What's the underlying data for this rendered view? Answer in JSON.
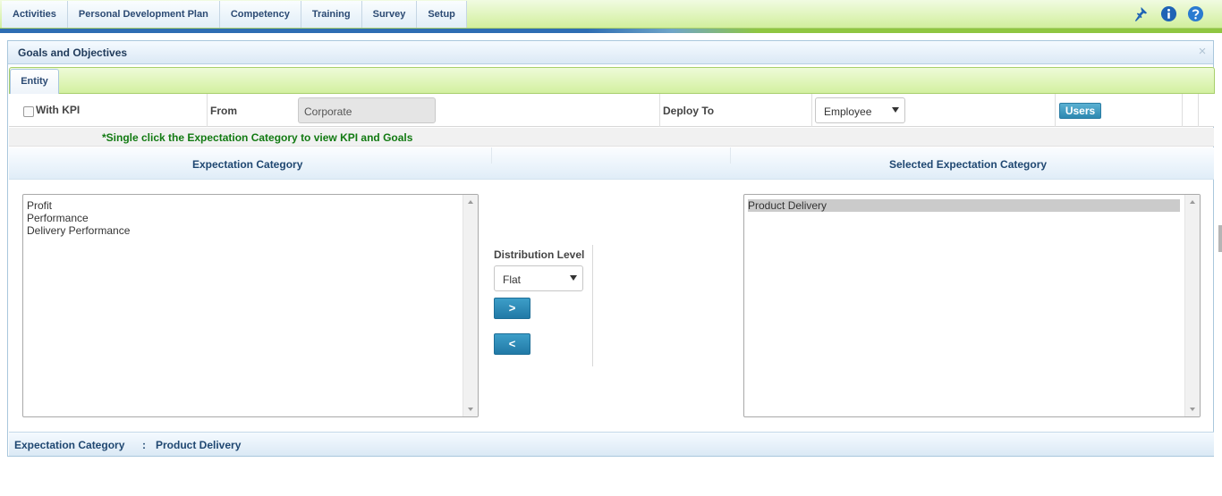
{
  "nav": {
    "items": [
      {
        "label": "Activities"
      },
      {
        "label": "Personal Development Plan"
      },
      {
        "label": "Competency"
      },
      {
        "label": "Training"
      },
      {
        "label": "Survey"
      },
      {
        "label": "Setup"
      }
    ],
    "icons": [
      "pin-icon",
      "info-icon",
      "help-icon"
    ]
  },
  "panel": {
    "title": "Goals and Objectives",
    "close_glyph": "×",
    "tab": "Entity"
  },
  "form": {
    "with_kpi_label": "With KPI",
    "with_kpi_checked": false,
    "from_label": "From",
    "from_value": "Corporate",
    "deploy_to_label": "Deploy To",
    "deploy_to_value": "Employee",
    "users_button": "Users"
  },
  "note": "*Single click the Expectation Category to view KPI and Goals",
  "columns": {
    "left_title": "Expectation Category",
    "right_title": "Selected Expectation Category"
  },
  "available_list": {
    "items": [
      "Profit",
      "Performance",
      "Delivery Performance"
    ]
  },
  "selected_list": {
    "items": [
      "Product Delivery"
    ],
    "selected_index": 0
  },
  "distribution": {
    "label": "Distribution Level",
    "value": "Flat",
    "add_button": ">",
    "remove_button": "<"
  },
  "footer": {
    "label": "Expectation Category",
    "separator": ":",
    "value": "Product Delivery"
  },
  "colors": {
    "nav_green": "#d2ef9d",
    "header_blue": "#1f4771",
    "note_green": "#127a12",
    "button_blue": "#2d88b1"
  }
}
